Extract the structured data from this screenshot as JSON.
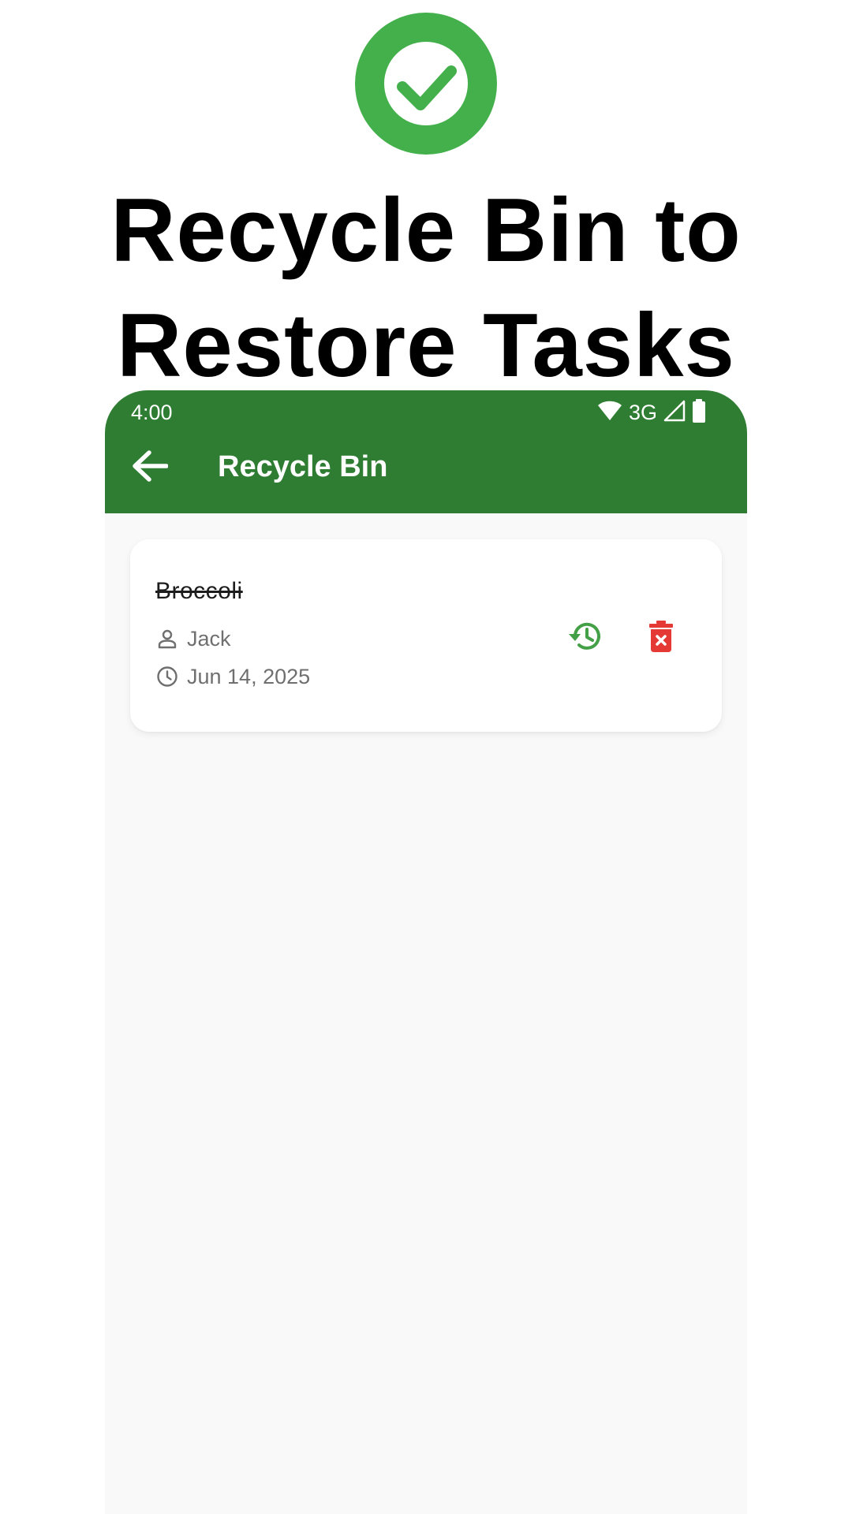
{
  "hero": {
    "title_line1": "Recycle Bin to",
    "title_line2": "Restore Tasks",
    "badge_icon": "check-circle-icon",
    "badge_color": "#43b04b"
  },
  "status_bar": {
    "time": "4:00",
    "network": "3G",
    "icons": [
      "wifi-icon",
      "cellular-signal-icon",
      "battery-icon"
    ]
  },
  "app_bar": {
    "title": "Recycle Bin",
    "back_icon": "arrow-back-icon",
    "background": "#2e7d32"
  },
  "tasks": [
    {
      "title": "Broccoli",
      "assignee": "Jack",
      "date": "Jun 14, 2025",
      "completed": true,
      "restore_icon": "restore-history-icon",
      "delete_icon": "delete-forever-icon",
      "restore_color": "#43a047",
      "delete_color": "#e53935"
    }
  ]
}
